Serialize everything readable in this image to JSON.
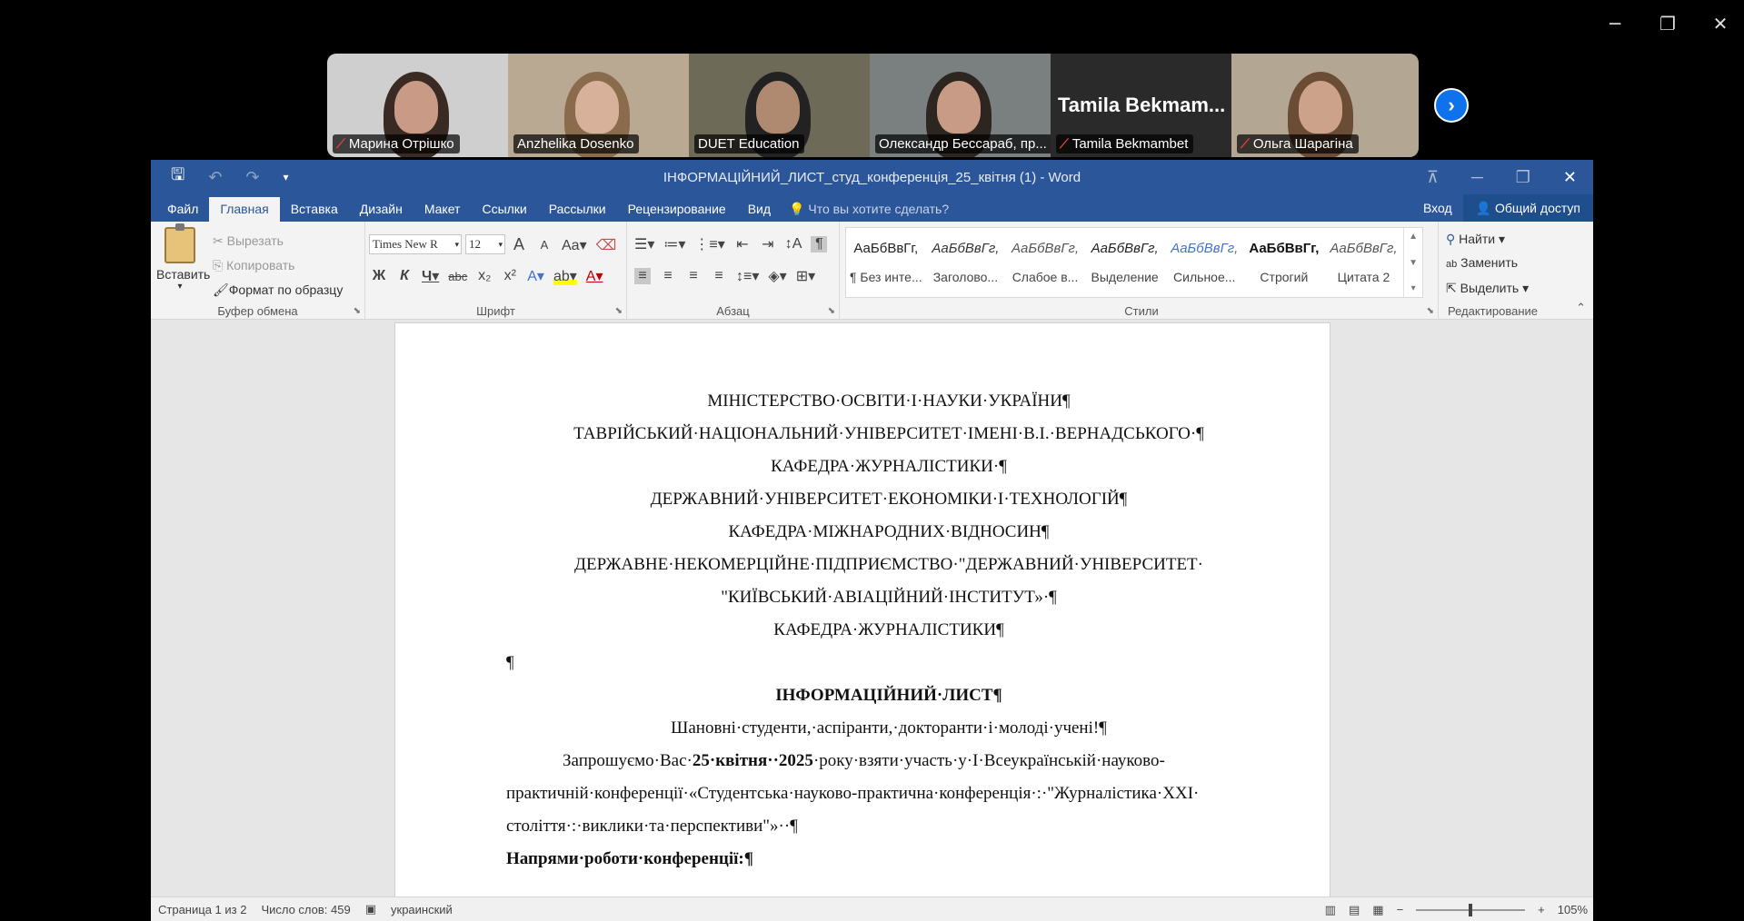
{
  "window_controls": {
    "minimize": "─",
    "restore": "❐",
    "close": "✕"
  },
  "participants": [
    {
      "name": "Марина Отрішко",
      "muted": true,
      "bg": "#cfcfcf",
      "skin": "#c99b86",
      "hair": "#3a2a24"
    },
    {
      "name": "Anzhelika Dosenko",
      "muted": false,
      "bg": "#b9a892",
      "skin": "#d8b19a",
      "hair": "#8a6b4b"
    },
    {
      "name": "DUET Education",
      "muted": false,
      "bg": "#6d6a58",
      "skin": "#b08a70",
      "hair": "#222",
      "active": true
    },
    {
      "name": "Олександр Бессараб,  пр...",
      "muted": false,
      "bg": "#7a7f80",
      "skin": "#c79b86",
      "hair": "#2c2520"
    },
    {
      "name": "Tamila Bekmambet",
      "muted": true,
      "bg": "#2a2a2a",
      "big_name": "Tamila  Bekmam..."
    },
    {
      "name": "Ольга Шарагіна",
      "muted": true,
      "bg": "#b3a693",
      "skin": "#cda28a",
      "hair": "#6b4c34"
    }
  ],
  "next_icon": "›",
  "word": {
    "title": "ІНФОРМАЦІЙНИЙ_ЛИСТ_студ_конференція_25_квітня (1) - Word",
    "qat": {
      "save": "🖫",
      "undo": "↶",
      "redo": "↷",
      "customize": "▾"
    },
    "title_controls": {
      "ribbon_options": "⊼",
      "minimize": "─",
      "maximize": "❐",
      "close": "✕"
    },
    "tabs": [
      "Файл",
      "Главная",
      "Вставка",
      "Дизайн",
      "Макет",
      "Ссылки",
      "Рассылки",
      "Рецензирование",
      "Вид"
    ],
    "active_tab": "Главная",
    "search": "Что вы хотите сделать?",
    "login": "Вход",
    "share": "Общий доступ",
    "clipboard": {
      "paste": "Вставить",
      "cut": "Вырезать",
      "copy": "Копировать",
      "format_painter": "Формат по образцу",
      "label": "Буфер обмена"
    },
    "font": {
      "name": "Times New R",
      "size": "12",
      "label": "Шрифт",
      "row1": [
        "A",
        "A",
        "Aa▾",
        "⌫"
      ],
      "row2": [
        "Ж",
        "К",
        "Ч▾",
        "abc",
        "x₂",
        "x²",
        "A▾",
        "ab▾",
        "A▾"
      ]
    },
    "paragraph": {
      "label": "Абзац",
      "row1": [
        "☰▾",
        "≔▾",
        "⋮≡▾",
        "⇤",
        "⇥",
        "↕A",
        "¶"
      ],
      "row2": [
        "≡",
        "≡",
        "≡",
        "≡",
        "↕≡▾",
        "◈▾",
        "⊞▾"
      ]
    },
    "styles": {
      "label": "Стили",
      "items": [
        {
          "preview": "АаБбВвГг,",
          "name": "¶ Без инте...",
          "color": "#222",
          "italic": false,
          "bold": false
        },
        {
          "preview": "АаБбВвГг,",
          "name": "Заголово...",
          "color": "#333",
          "italic": true,
          "bold": false
        },
        {
          "preview": "АаБбВвГг,",
          "name": "Слабое в...",
          "color": "#555",
          "italic": true,
          "bold": false
        },
        {
          "preview": "АаБбВвГг,",
          "name": "Выделение",
          "color": "#222",
          "italic": true,
          "bold": false
        },
        {
          "preview": "АаБбВвГг,",
          "name": "Сильное...",
          "color": "#4472c4",
          "italic": true,
          "bold": false
        },
        {
          "preview": "АаБбВвГг,",
          "name": "Строгий",
          "color": "#111",
          "italic": false,
          "bold": true
        },
        {
          "preview": "АаБбВвГг,",
          "name": "Цитата 2",
          "color": "#555",
          "italic": true,
          "bold": false
        }
      ]
    },
    "editing": {
      "label": "Редактирование",
      "find": "Найти ▾",
      "replace": "Заменить",
      "select": "Выделить ▾"
    },
    "document": {
      "lines": [
        "МІНІСТЕРСТВО·ОСВІТИ·І·НАУКИ·УКРАЇНИ¶",
        "ТАВРІЙСЬКИЙ·НАЦІОНАЛЬНИЙ·УНІВЕРСИТЕТ·ІМЕНІ·В.І.·ВЕРНАДСЬКОГО·¶",
        "КАФЕДРА·ЖУРНАЛІСТИКИ·¶",
        "ДЕРЖАВНИЙ·УНІВЕРСИТЕТ·ЕКОНОМІКИ·І·ТЕХНОЛОГІЙ¶",
        "КАФЕДРА·МІЖНАРОДНИХ·ВІДНОСИН¶",
        "ДЕРЖАВНЕ·НЕКОМЕРЦІЙНЕ·ПІДПРИЄМСТВО·\"ДЕРЖАВНИЙ·УНІВЕРСИТЕТ·",
        "\"КИЇВСЬКИЙ·АВІАЦІЙНИЙ·ІНСТИТУТ»·¶",
        "КАФЕДРА·ЖУРНАЛІСТИКИ¶"
      ],
      "empty_para": "¶",
      "heading": "ІНФОРМАЦІЙНИЙ·ЛИСТ¶",
      "greeting": "Шановні·студенти,·аспіранти,·докторанти·і·молоді·учені!¶",
      "invite_a": "Запрошуємо·Вас·",
      "invite_b": "25·квітня··2025",
      "invite_c": "·року·взяти·участь·у·І·Всеукраїнській·науково-",
      "invite_line2": "практичній·конференції·«Студентська·науково-практична·конференція·:·\"Журналістика·XXI·",
      "invite_line3": "століття·:·виклики·та·перспективи\"»··¶",
      "directions": "Напрями·роботи·конференції:¶"
    },
    "status": {
      "page": "Страница 1 из 2",
      "words": "Число слов: 459",
      "lang": "украинский",
      "zoom": "105%",
      "zoom_fraction": 0.5
    }
  }
}
